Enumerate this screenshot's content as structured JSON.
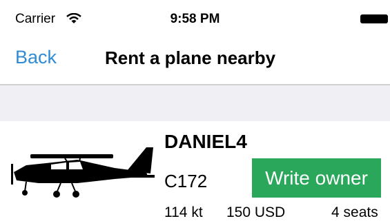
{
  "status_bar": {
    "carrier": "Carrier",
    "time": "9:58 PM",
    "wifi_icon": "wifi-icon",
    "battery_icon": "battery-icon"
  },
  "nav": {
    "back_label": "Back",
    "title": "Rent a plane nearby"
  },
  "listing": {
    "name": "DANIEL4",
    "model": "C172",
    "speed": "114 kt",
    "price": "150 USD",
    "seats": "4 seats",
    "action_label": "Write owner",
    "image_icon": "airplane-icon"
  },
  "colors": {
    "accent": "#2f8bd6",
    "button": "#2aa75b",
    "band": "#efeff4"
  }
}
